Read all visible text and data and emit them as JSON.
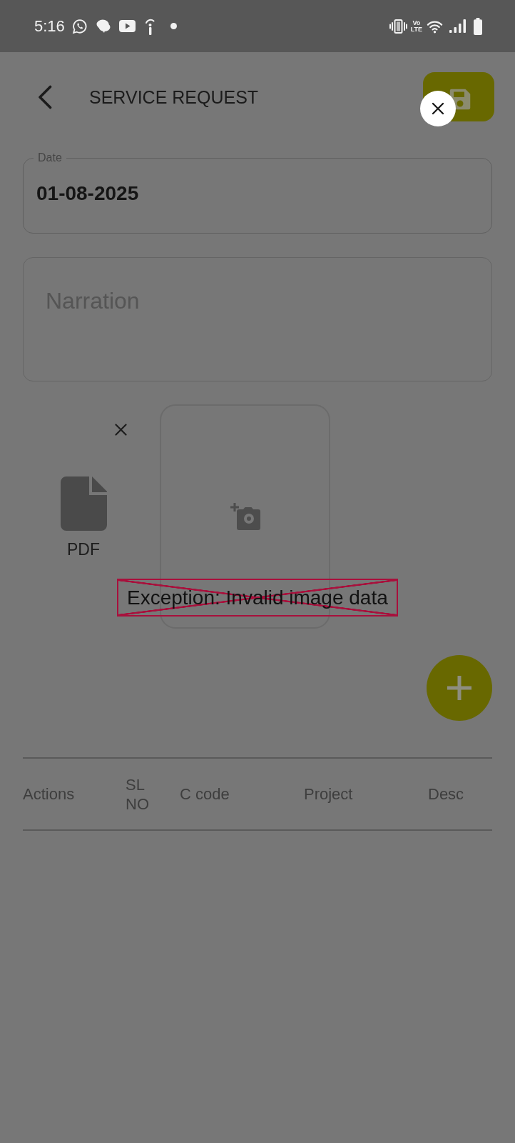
{
  "status_bar": {
    "time": "5:16",
    "volte": [
      "Vo",
      "LTE"
    ]
  },
  "header": {
    "title": "SERVICE REQUEST"
  },
  "date_field": {
    "label": "Date",
    "value": "01-08-2025"
  },
  "narration_field": {
    "placeholder": "Narration"
  },
  "attachments": [
    {
      "kind": "file",
      "label": "PDF"
    },
    {
      "kind": "add_photo"
    }
  ],
  "image_error": {
    "message": "Exception: Invalid image data"
  },
  "table": {
    "columns": [
      "Actions",
      "SL NO",
      "C code",
      "Project",
      "Desc"
    ]
  }
}
